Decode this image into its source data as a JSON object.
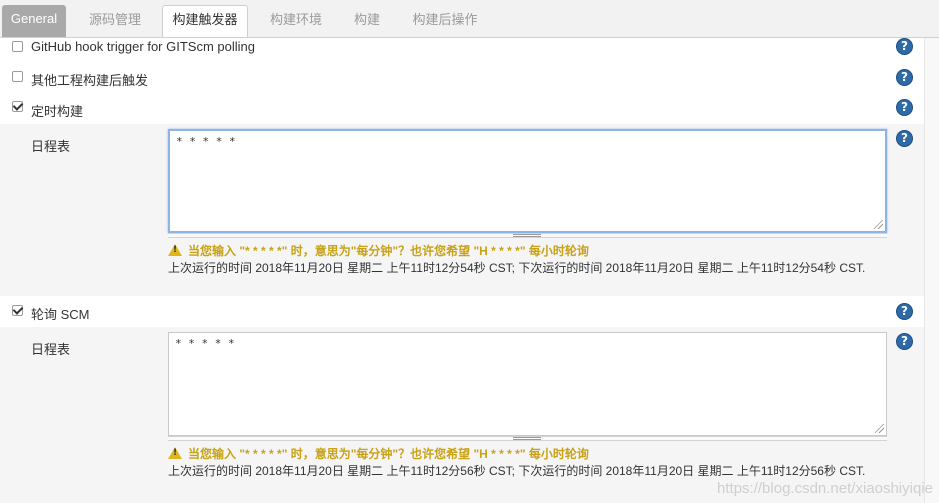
{
  "tabs": [
    {
      "label": "General"
    },
    {
      "label": "源码管理"
    },
    {
      "label": "构建触发器"
    },
    {
      "label": "构建环境"
    },
    {
      "label": "构建"
    },
    {
      "label": "构建后操作"
    }
  ],
  "triggers": {
    "github_hook": {
      "label": "GitHub hook trigger for GITScm polling",
      "checked": false
    },
    "other_projects": {
      "label": "其他工程构建后触发",
      "checked": false
    },
    "build_periodically": {
      "label": "定时构建",
      "checked": true
    },
    "poll_scm": {
      "label": "轮询 SCM",
      "checked": true
    }
  },
  "periodic_schedule": {
    "label": "日程表",
    "value": "* * * * *",
    "warning": "当您输入 \"* * * * *\" 时，意思为\"每分钟\"？也许您希望 \"H * * * *\" 每小时轮询",
    "info": "上次运行的时间 2018年11月20日 星期二 上午11时12分54秒 CST; 下次运行的时间 2018年11月20日 星期二 上午11时12分54秒 CST."
  },
  "scm_schedule": {
    "label": "日程表",
    "value": "* * * * *",
    "warning": "当您输入 \"* * * * *\" 时，意思为\"每分钟\"？也许您希望 \"H * * * *\" 每小时轮询",
    "info": "上次运行的时间 2018年11月20日 星期二 上午11时12分56秒 CST; 下次运行的时间 2018年11月20日 星期二 上午11时12分56秒 CST."
  },
  "help_glyph": "?",
  "watermark": "https://blog.csdn.net/xiaoshiyiqie",
  "colors": {
    "help": "#2e6aa8",
    "warning": "#c8a217",
    "focus": "#8eb4e6"
  }
}
